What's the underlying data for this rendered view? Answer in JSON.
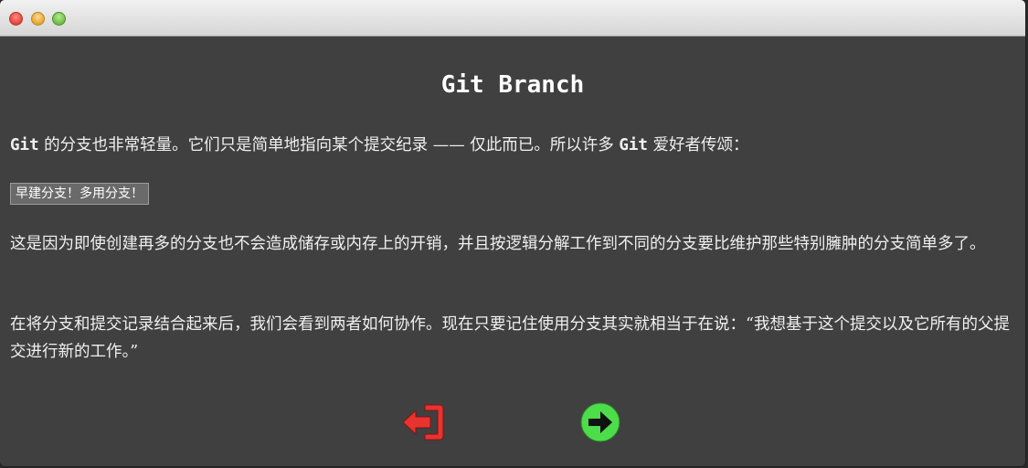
{
  "window": {
    "controls": [
      "close",
      "minimize",
      "zoom"
    ]
  },
  "dialog": {
    "title": "Git Branch",
    "paragraph1": {
      "term1": "Git",
      "text1": " 的分支也非常轻量。它们只是简单地指向某个提交纪录 —— 仅此而已。所以许多 ",
      "term2": "Git",
      "text2": " 爱好者传颂："
    },
    "quote": "早建分支！多用分支！",
    "paragraph2": "这是因为即使创建再多的分支也不会造成储存或内存上的开销，并且按逻辑分解工作到不同的分支要比维护那些特别臃肿的分支简单多了。",
    "paragraph3": "在将分支和提交记录结合起来后，我们会看到两者如何协作。现在只要记住使用分支其实就相当于在说：“我想基于这个提交以及它所有的父提交进行新的工作。”"
  },
  "navigation": {
    "exit_icon": "exit-door-icon",
    "next_icon": "arrow-right-circle-icon",
    "exit_color": "#e8332f",
    "next_color": "#4ddc4a"
  }
}
